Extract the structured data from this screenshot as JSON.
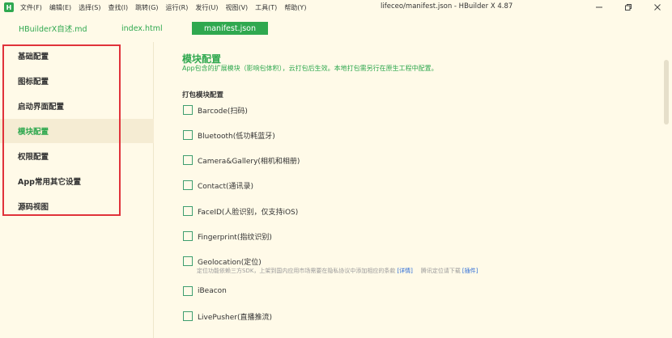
{
  "app": {
    "logo_letter": "H",
    "window_title": "lifeceo/manifest.json - HBuilder X 4.87"
  },
  "menu": [
    "文件(F)",
    "编辑(E)",
    "选择(S)",
    "查找(I)",
    "跳转(G)",
    "运行(R)",
    "发行(U)",
    "视图(V)",
    "工具(T)",
    "帮助(Y)"
  ],
  "tabs": [
    {
      "label": "HBuilderX自述.md"
    },
    {
      "label": "index.html"
    },
    {
      "label": "manifest.json",
      "active": true
    }
  ],
  "sidebar": {
    "items": [
      {
        "label": "基础配置"
      },
      {
        "label": "图标配置"
      },
      {
        "label": "启动界面配置"
      },
      {
        "label": "模块配置",
        "active": true
      },
      {
        "label": "权限配置"
      },
      {
        "label": "App常用其它设置"
      },
      {
        "label": "源码视图"
      }
    ]
  },
  "main": {
    "title": "模块配置",
    "description": "App包含的扩展模块（影响包体积），云打包后生效。本地打包需另行在原生工程中配置。",
    "group_title": "打包模块配置",
    "modules": [
      {
        "label": "Barcode(扫码)"
      },
      {
        "label": "Bluetooth(低功耗蓝牙)"
      },
      {
        "label": "Camera&Gallery(相机和相册)"
      },
      {
        "label": "Contact(通讯录)"
      },
      {
        "label": "FaceID(人脸识别，仅支持iOS)"
      },
      {
        "label": "Fingerprint(指纹识别)"
      },
      {
        "label": "Geolocation(定位)"
      },
      {
        "label": "iBeacon"
      },
      {
        "label": "LivePusher(直播推流)"
      }
    ],
    "geolocation_note": {
      "text": "定位功能依赖三方SDK，上架到国内应用市场需要在隐私协议中添加相应的条款",
      "detail_link": "[详情]",
      "tencent_text": "腾讯定位请下载",
      "plugin_link": "[插件]"
    }
  },
  "colors": {
    "accent": "#2fa84f",
    "background": "#fffae8",
    "highlight": "#e0323a",
    "link": "#2a6ad6"
  }
}
